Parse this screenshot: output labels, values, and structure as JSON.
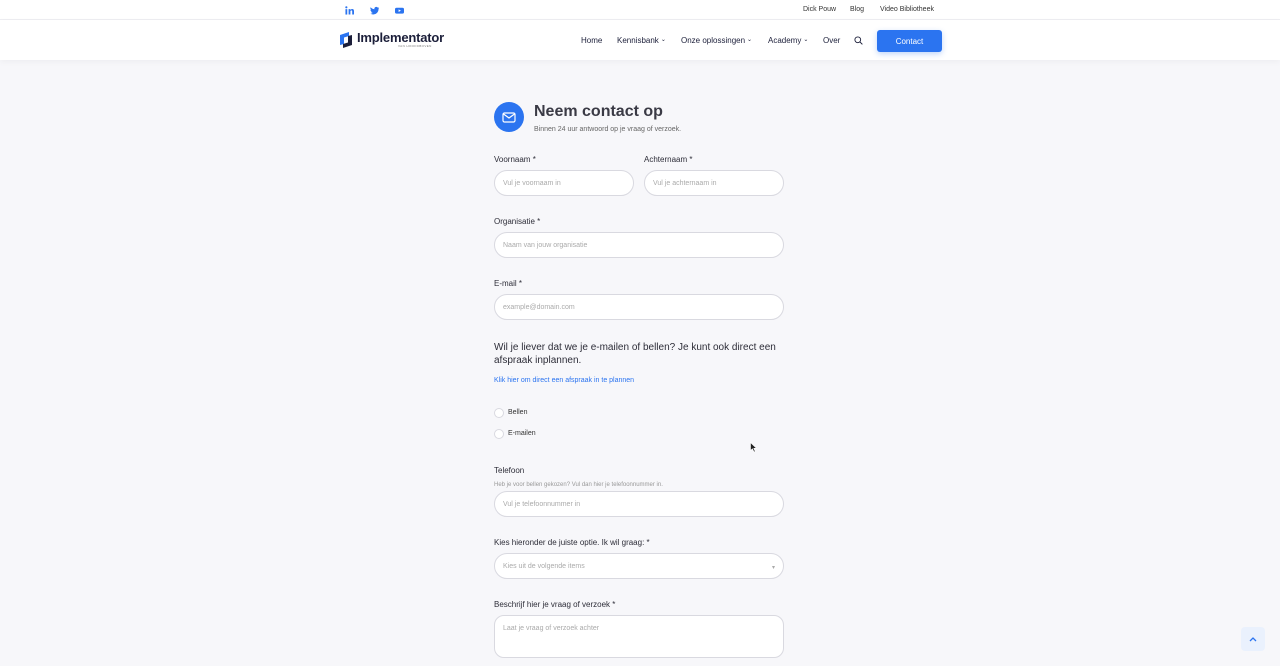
{
  "topbar": {
    "social": [
      "linkedin-icon",
      "twitter-icon",
      "youtube-icon"
    ],
    "links": [
      "Dick Pouw",
      "Blog",
      "Video Bibliotheek"
    ]
  },
  "nav": {
    "logo_text": "Implementator",
    "logo_sub": "VAN HOOFDBOVEN",
    "items": [
      "Home",
      "Kennisbank",
      "Onze oplossingen",
      "Academy",
      "Over"
    ],
    "contact_label": "Contact"
  },
  "form": {
    "title": "Neem contact op",
    "subtitle": "Binnen 24 uur antwoord op je vraag of verzoek.",
    "first_name_label": "Voornaam *",
    "first_name_placeholder": "Vul je voornaam in",
    "last_name_label": "Achternaam *",
    "last_name_placeholder": "Vul je achternaam in",
    "org_label": "Organisatie *",
    "org_placeholder": "Naam van jouw organisatie",
    "email_label": "E-mail *",
    "email_placeholder": "example@domain.com",
    "question": "Wil je liever dat we je e-mailen of bellen? Je kunt ook direct een afspraak inplannen.",
    "plan_link": "Klik hier om direct een afspraak in te plannen",
    "radio_call": "Bellen",
    "radio_email": "E-mailen",
    "phone_label": "Telefoon",
    "phone_hint": "Heb je voor bellen gekozen? Vul dan hier je telefoonnummer in.",
    "phone_placeholder": "Vul je telefoonnummer in",
    "option_label": "Kies hieronder de juiste optie. Ik wil graag: *",
    "option_placeholder": "Kies uit de volgende items",
    "describe_label": "Beschrijf hier je vraag of verzoek *",
    "describe_placeholder": "Laat je vraag of verzoek achter"
  },
  "colors": {
    "accent": "#2b74f0",
    "text_dark": "#1c1f3a",
    "background": "#f7f7fa"
  }
}
